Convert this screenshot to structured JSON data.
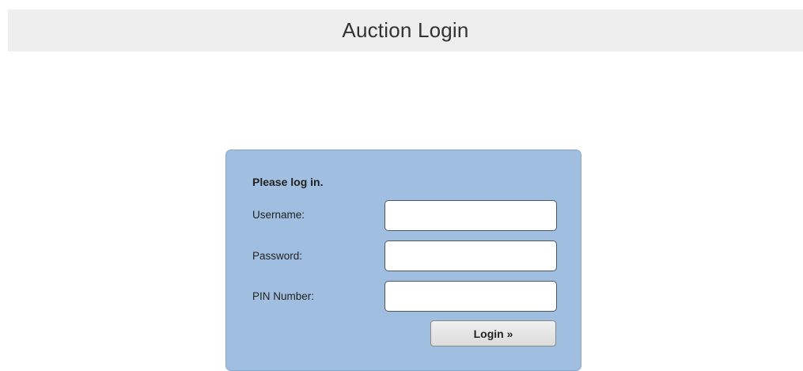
{
  "header": {
    "title": "Auction Login"
  },
  "login_form": {
    "heading": "Please log in.",
    "fields": [
      {
        "label": "Username:",
        "value": "",
        "placeholder": ""
      },
      {
        "label": "Password:",
        "value": "",
        "placeholder": ""
      },
      {
        "label": "PIN Number:",
        "value": "",
        "placeholder": ""
      }
    ],
    "submit_label": "Login »"
  },
  "colors": {
    "header_background": "#eeeeee",
    "panel_background": "#a0bfe0",
    "button_background": "#e2e2e2"
  }
}
